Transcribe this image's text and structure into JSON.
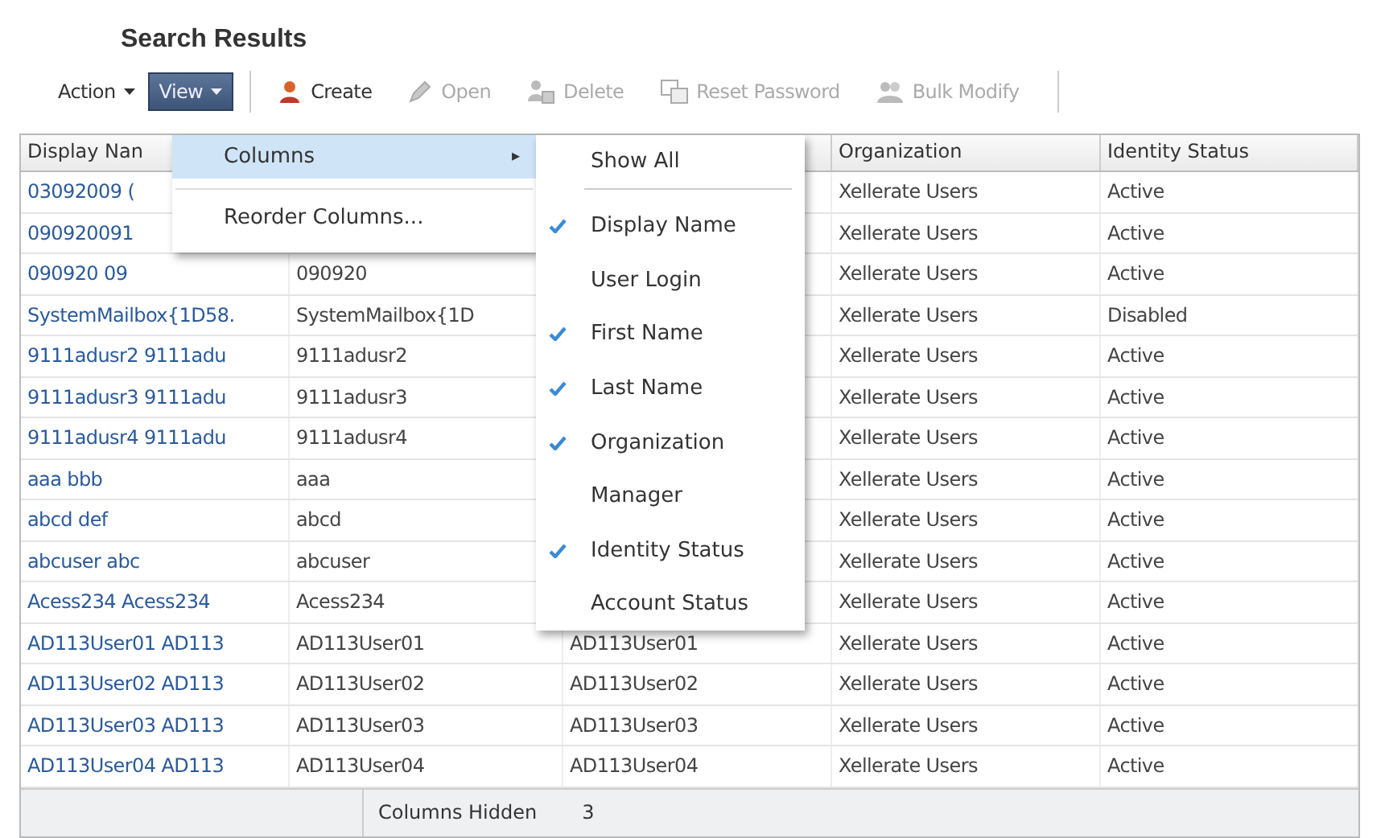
{
  "title": "Search Results",
  "toolbar": [
    {
      "label": "Action",
      "kind": "menu",
      "selected": false,
      "disabled": false
    },
    {
      "label": "View",
      "kind": "menu",
      "selected": true,
      "disabled": false
    },
    {
      "label": "Create",
      "kind": "create",
      "selected": false,
      "disabled": false
    },
    {
      "label": "Open",
      "kind": "open",
      "selected": false,
      "disabled": true
    },
    {
      "label": "Delete",
      "kind": "delete",
      "selected": false,
      "disabled": true
    },
    {
      "label": "Reset Password",
      "kind": "reset",
      "selected": false,
      "disabled": true
    },
    {
      "label": "Bulk Modify",
      "kind": "bulk",
      "selected": false,
      "disabled": true
    }
  ],
  "table": {
    "columns": {
      "display_name": "Display Nan",
      "organization": "Organization",
      "identity_status": "Identity Status"
    },
    "rows": [
      {
        "display_name": "03092009 (",
        "organization": "Xellerate Users",
        "identity_status": "Active"
      },
      {
        "display_name": "090920091",
        "organization": "Xellerate Users",
        "identity_status": "Active"
      },
      {
        "display_name": "090920 09",
        "user_login": "090920",
        "organization": "Xellerate Users",
        "identity_status": "Active"
      },
      {
        "display_name": "SystemMailbox{1D58.",
        "user_login": "SystemMailbox{1D",
        "organization": "Xellerate Users",
        "identity_status": "Disabled"
      },
      {
        "display_name": "9111adusr2 9111adu",
        "user_login": "9111adusr2",
        "organization": "Xellerate Users",
        "identity_status": "Active"
      },
      {
        "display_name": "9111adusr3 9111adu",
        "user_login": "9111adusr3",
        "organization": "Xellerate Users",
        "identity_status": "Active"
      },
      {
        "display_name": "9111adusr4 9111adu",
        "user_login": "9111adusr4",
        "organization": "Xellerate Users",
        "identity_status": "Active"
      },
      {
        "display_name": "aaa bbb",
        "user_login": "aaa",
        "organization": "Xellerate Users",
        "identity_status": "Active"
      },
      {
        "display_name": "abcd def",
        "user_login": "abcd",
        "organization": "Xellerate Users",
        "identity_status": "Active"
      },
      {
        "display_name": "abcuser abc",
        "user_login": "abcuser",
        "organization": "Xellerate Users",
        "identity_status": "Active"
      },
      {
        "display_name": "Acess234 Acess234",
        "user_login": "Acess234",
        "organization": "Xellerate Users",
        "identity_status": "Active"
      },
      {
        "display_name": "AD113User01 AD113",
        "user_login": "AD113User01",
        "column_3": "AD113User01",
        "organization": "Xellerate Users",
        "identity_status": "Active"
      },
      {
        "display_name": "AD113User02 AD113",
        "user_login": "AD113User02",
        "column_3": "AD113User02",
        "organization": "Xellerate Users",
        "identity_status": "Active"
      },
      {
        "display_name": "AD113User03 AD113",
        "user_login": "AD113User03",
        "column_3": "AD113User03",
        "organization": "Xellerate Users",
        "identity_status": "Active"
      },
      {
        "display_name": "AD113User04 AD113",
        "user_login": "AD113User04",
        "column_3": "AD113User04",
        "organization": "Xellerate Users",
        "identity_status": "Active"
      }
    ]
  },
  "view_menu": [
    {
      "label": "Columns",
      "selected": true,
      "submenu_arrow": "▸"
    },
    {
      "label": "Reorder Columns...",
      "selected": false
    }
  ],
  "columns_submenu": [
    {
      "label": "Show All",
      "kind": "action"
    },
    {
      "label": "Display Name",
      "kind": "toggle",
      "checked": true
    },
    {
      "label": "User Login",
      "kind": "toggle",
      "checked": false
    },
    {
      "label": "First Name",
      "kind": "toggle",
      "checked": true
    },
    {
      "label": "Last Name",
      "kind": "toggle",
      "checked": true
    },
    {
      "label": "Organization",
      "kind": "toggle",
      "checked": true
    },
    {
      "label": "Manager",
      "kind": "toggle",
      "checked": false
    },
    {
      "label": "Identity Status",
      "kind": "toggle",
      "checked": true
    },
    {
      "label": "Account Status",
      "kind": "toggle",
      "checked": false
    }
  ],
  "status_bar": {
    "label": "Columns Hidden",
    "value": "3"
  }
}
